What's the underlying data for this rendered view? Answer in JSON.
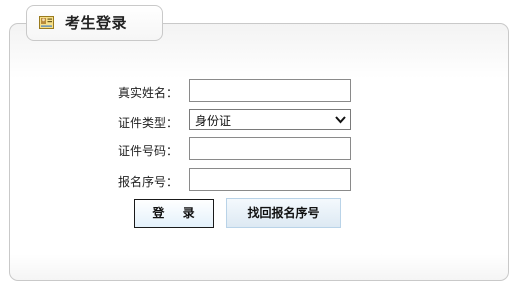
{
  "panel": {
    "title": "考生登录",
    "title_icon": "id-card-icon"
  },
  "form": {
    "real_name": {
      "label": "真实姓名：",
      "value": ""
    },
    "id_type": {
      "label": "证件类型：",
      "selected": "身份证"
    },
    "id_number": {
      "label": "证件号码：",
      "value": ""
    },
    "reg_number": {
      "label": "报名序号：",
      "value": ""
    }
  },
  "buttons": {
    "login_label": "登 录",
    "recover_label": "找回报名序号"
  }
}
